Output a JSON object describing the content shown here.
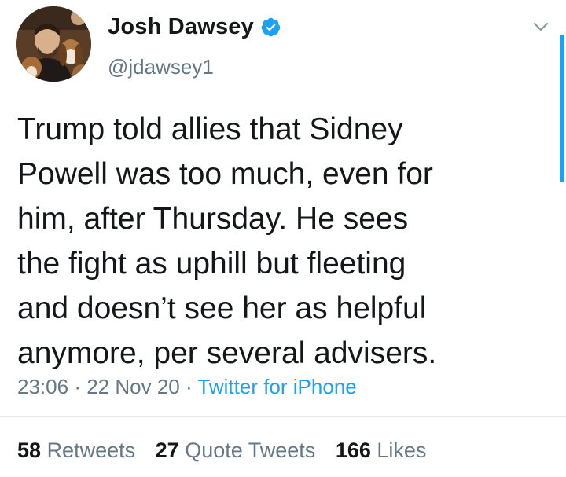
{
  "author": {
    "display_name": "Josh Dawsey",
    "handle": "@jdawsey1",
    "verified": true
  },
  "tweet": {
    "text_lines": [
      "Trump told allies that Sidney",
      "Powell was too much, even for",
      "him, after Thursday. He sees",
      "the fight as uphill but fleeting",
      "and doesn’t see her as helpful",
      "anymore, per several advisers."
    ],
    "time": "23:06",
    "separator": "·",
    "date": "22 Nov 20",
    "source": "Twitter for iPhone"
  },
  "stats": {
    "retweets_count": "58",
    "retweets_label": "Retweets",
    "quotes_count": "27",
    "quotes_label": "Quote Tweets",
    "likes_count": "166",
    "likes_label": "Likes"
  },
  "colors": {
    "accent": "#1da1f2",
    "text_primary": "#14171a",
    "text_secondary": "#657786"
  },
  "icons": {
    "verified": "verified-badge-icon",
    "menu": "chevron-down-icon"
  }
}
